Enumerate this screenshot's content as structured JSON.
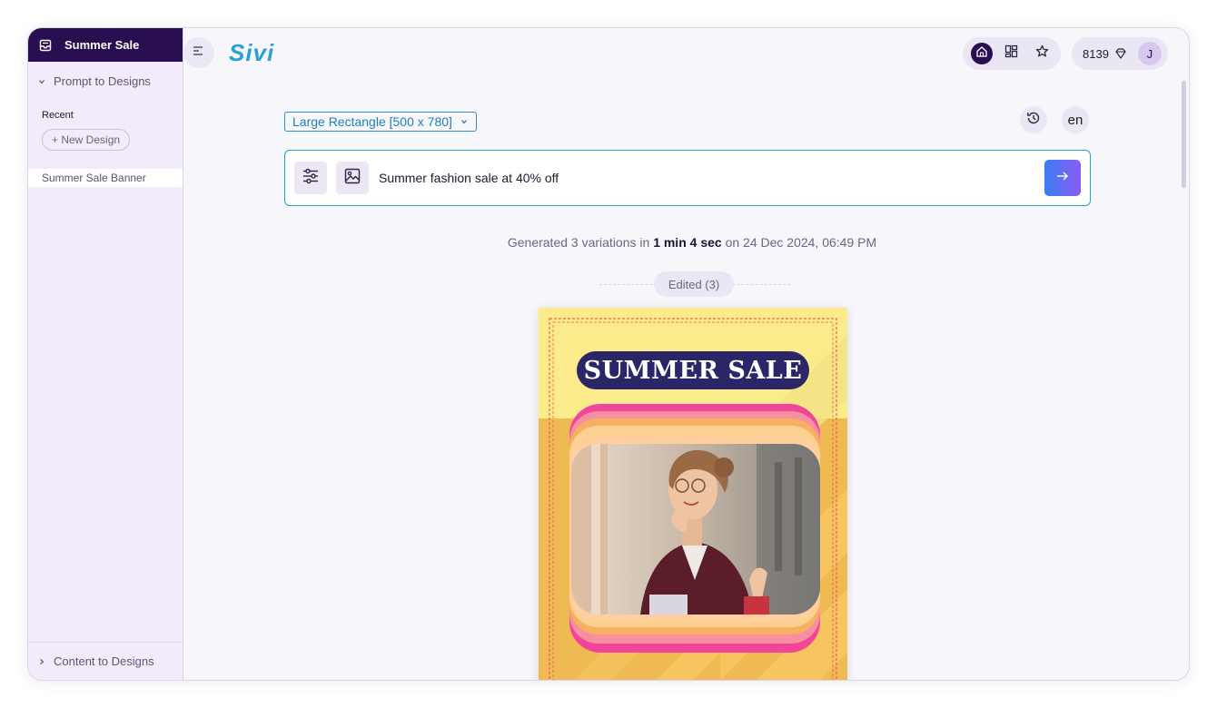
{
  "sidebar": {
    "workspace_title": "Summer Sale",
    "section_prompt": "Prompt to Designs",
    "recent_label": "Recent",
    "new_design_label": "+ New Design",
    "items": [
      {
        "label": "Summer Sale Banner"
      }
    ],
    "section_content": "Content to Designs"
  },
  "header": {
    "logo": "Sivi",
    "credits": "8139",
    "avatar_initial": "J",
    "nav_icons": [
      "home-icon",
      "grid-icon",
      "star-icon"
    ]
  },
  "toolbar": {
    "size_select": "Large Rectangle [500 x 780]",
    "language": "en"
  },
  "prompt": {
    "value": "Summer fashion sale at 40% off"
  },
  "generation": {
    "prefix": "Generated 3 variations in",
    "duration": "1 min 4 sec",
    "suffix": "on 24 Dec 2024, 06:49 PM"
  },
  "edited_badge": "Edited (3)",
  "banner": {
    "title": "SUMMER SALE"
  },
  "colors": {
    "sidebar_header": "#2a0e52",
    "accent_blue": "#2b8fd0",
    "banner_yellow": "#fbeb8a",
    "banner_orange": "#efba54",
    "banner_pink": "#f0459a",
    "banner_pill": "#2b2668"
  }
}
